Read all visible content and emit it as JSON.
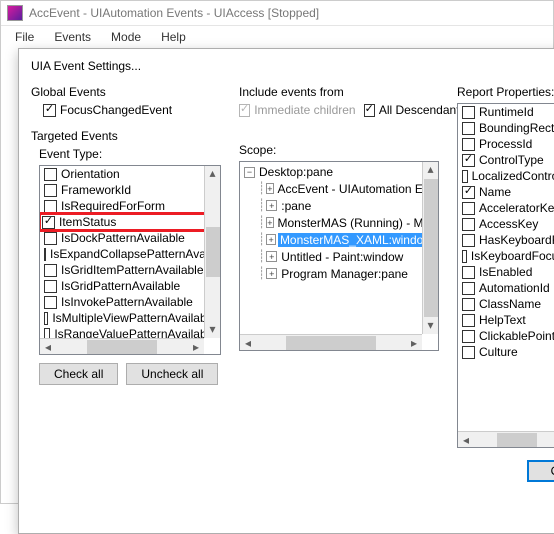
{
  "window": {
    "title": "AccEvent - UIAutomation Events - UIAccess [Stopped]"
  },
  "menu": {
    "file": "File",
    "events": "Events",
    "mode": "Mode",
    "help": "Help"
  },
  "dialog": {
    "title": "UIA Event Settings..."
  },
  "global": {
    "label": "Global Events",
    "focusChanged": "FocusChangedEvent"
  },
  "include": {
    "label": "Include events from",
    "immediate": "Immediate children",
    "allDesc": "All Descendants"
  },
  "targeted": {
    "label": "Targeted Events",
    "eventType": "Event Type:"
  },
  "eventItems": [
    "Orientation",
    "FrameworkId",
    "IsRequiredForForm",
    "ItemStatus",
    "IsDockPatternAvailable",
    "IsExpandCollapsePatternAvailable",
    "IsGridItemPatternAvailable",
    "IsGridPatternAvailable",
    "IsInvokePatternAvailable",
    "IsMultipleViewPatternAvailable",
    "IsRangeValuePatternAvailable"
  ],
  "scope": {
    "label": "Scope:"
  },
  "tree": {
    "root": "Desktop:pane",
    "n1": "AccEvent - UIAutomation Events",
    "n2": ":pane",
    "n3": "MonsterMAS (Running) - Microsoft",
    "n4": "MonsterMAS_XAML:window",
    "n5": "Untitled - Paint:window",
    "n6": "Program Manager:pane"
  },
  "report": {
    "label": "Report Properties:",
    "items": [
      {
        "label": "RuntimeId",
        "checked": false
      },
      {
        "label": "BoundingRectangle",
        "checked": false
      },
      {
        "label": "ProcessId",
        "checked": false
      },
      {
        "label": "ControlType",
        "checked": true
      },
      {
        "label": "LocalizedControlType",
        "checked": false
      },
      {
        "label": "Name",
        "checked": true
      },
      {
        "label": "AcceleratorKey",
        "checked": false
      },
      {
        "label": "AccessKey",
        "checked": false
      },
      {
        "label": "HasKeyboardFocus",
        "checked": false
      },
      {
        "label": "IsKeyboardFocusable",
        "checked": false
      },
      {
        "label": "IsEnabled",
        "checked": false
      },
      {
        "label": "AutomationId",
        "checked": false
      },
      {
        "label": "ClassName",
        "checked": false
      },
      {
        "label": "HelpText",
        "checked": false
      },
      {
        "label": "ClickablePoint",
        "checked": false
      },
      {
        "label": "Culture",
        "checked": false
      }
    ]
  },
  "buttons": {
    "checkAll": "Check all",
    "uncheckAll": "Uncheck all",
    "ok": "OK"
  }
}
